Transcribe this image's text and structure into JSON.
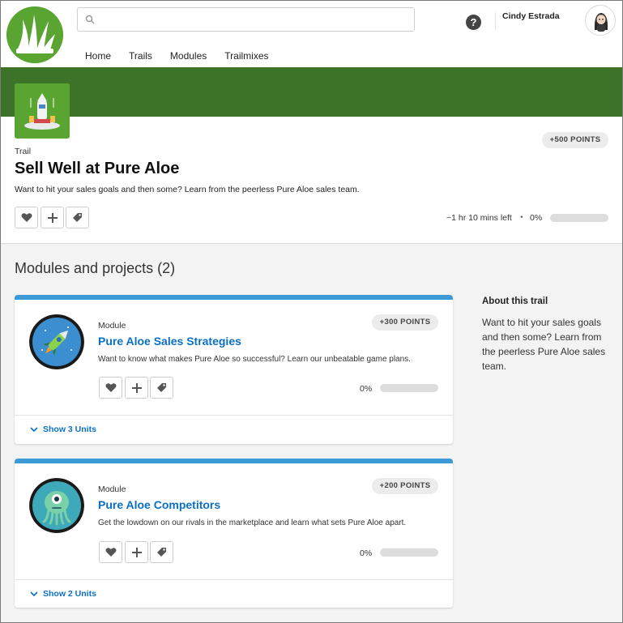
{
  "header": {
    "search": {
      "placeholder": "",
      "value": ""
    },
    "nav": [
      "Home",
      "Trails",
      "Modules",
      "Trailmixes"
    ],
    "help_label": "?",
    "user_name": "Cindy Estrada"
  },
  "trail": {
    "label": "Trail",
    "title": "Sell Well at Pure Aloe",
    "description": "Want to hit your sales goals and then some? Learn from the peerless Pure Aloe sales team.",
    "points": "+500 POINTS",
    "time_left": "~1 hr 10 mins left",
    "separator": "•",
    "progress_text": "0%",
    "progress": 0
  },
  "modules_section": {
    "title": "Modules and projects (2)"
  },
  "modules": [
    {
      "kind": "Module",
      "title": "Pure Aloe Sales Strategies",
      "description": "Want to know what makes Pure Aloe so successful? Learn our unbeatable game plans.",
      "points": "+300 POINTS",
      "progress_text": "0%",
      "progress": 0,
      "show_units": "Show 3 Units",
      "icon": "rocket-icon"
    },
    {
      "kind": "Module",
      "title": "Pure Aloe Competitors",
      "description": "Get the lowdown on our rivals in the marketplace and learn what sets Pure Aloe apart.",
      "points": "+200 POINTS",
      "progress_text": "0%",
      "progress": 0,
      "show_units": "Show 2 Units",
      "icon": "alien-icon"
    }
  ],
  "about": {
    "title": "About this trail",
    "body": "Want to hit your sales goals and then some? Learn from the peerless Pure Aloe sales team."
  },
  "colors": {
    "banner": "#3c7328",
    "brand_green": "#5aa531",
    "link_blue": "#0a70c4",
    "module_bar": "#3d9ad6"
  }
}
